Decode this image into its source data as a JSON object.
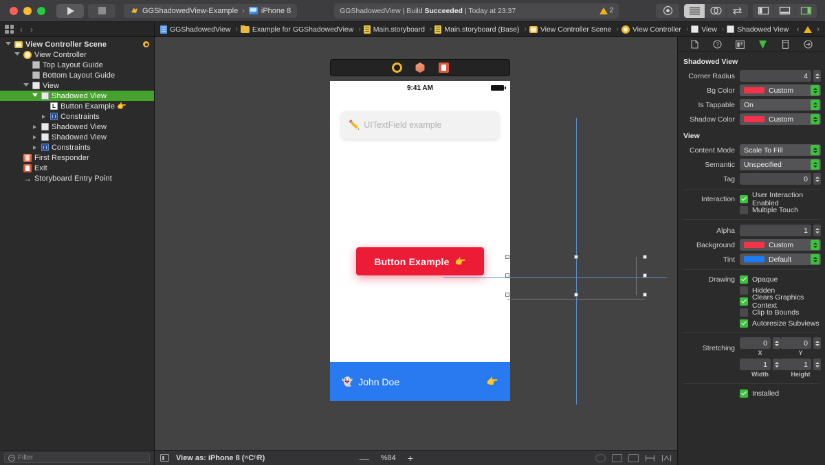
{
  "toolbar": {
    "run_icon": "play-icon",
    "stop_icon": "stop-icon",
    "scheme_name": "GGShadowedView-Example",
    "scheme_separator": "›",
    "destination": "iPhone 8",
    "status_prefix": "GGShadowedView | Build ",
    "status_result": "Succeeded",
    "status_suffix": " | Today at 23:37",
    "warning_count": "2",
    "buttons": {
      "library": "library-button",
      "standard_editor": "standard-editor-button",
      "assistant_editor": "assistant-editor-button",
      "version_editor": "version-editor-button",
      "navigator_toggle": "hide-navigator-button",
      "debug_toggle": "hide-debug-area-button",
      "inspector_toggle": "hide-inspector-button"
    }
  },
  "breadcrumb": {
    "back_label": "‹",
    "forward_label": "›",
    "items": [
      {
        "label": "GGShadowedView",
        "icon": "project-doc-icon"
      },
      {
        "label": "Example for GGShadowedView",
        "icon": "folder-icon"
      },
      {
        "label": "Main.storyboard",
        "icon": "storyboard-icon"
      },
      {
        "label": "Main.storyboard (Base)",
        "icon": "storyboard-icon"
      },
      {
        "label": "View Controller Scene",
        "icon": "scene-icon"
      },
      {
        "label": "View Controller",
        "icon": "view-controller-icon"
      },
      {
        "label": "View",
        "icon": "view-icon"
      },
      {
        "label": "Shadowed View",
        "icon": "view-icon"
      }
    ],
    "issue_prev": "‹",
    "issue_next": "›"
  },
  "navigator": {
    "tree": [
      {
        "label": "View Controller Scene",
        "indent": 0,
        "twisty": "open",
        "icon": "scene-icon",
        "bold": true,
        "selected": false,
        "badge": true
      },
      {
        "label": "View Controller",
        "indent": 1,
        "twisty": "open",
        "icon": "view-controller-icon",
        "bold": false,
        "selected": false
      },
      {
        "label": "Top Layout Guide",
        "indent": 2,
        "twisty": "none",
        "icon": "guide-icon",
        "bold": false,
        "selected": false
      },
      {
        "label": "Bottom Layout Guide",
        "indent": 2,
        "twisty": "none",
        "icon": "guide-icon",
        "bold": false,
        "selected": false
      },
      {
        "label": "View",
        "indent": 2,
        "twisty": "open",
        "icon": "view-icon",
        "bold": false,
        "selected": false
      },
      {
        "label": "Shadowed View",
        "indent": 3,
        "twisty": "open",
        "icon": "view-icon",
        "bold": false,
        "selected": true
      },
      {
        "label": "Button Example 👉",
        "indent": 4,
        "twisty": "none",
        "icon": "label-icon",
        "bold": false,
        "selected": false
      },
      {
        "label": "Constraints",
        "indent": 4,
        "twisty": "closed",
        "icon": "constraints-icon",
        "bold": false,
        "selected": false
      },
      {
        "label": "Shadowed View",
        "indent": 3,
        "twisty": "closed",
        "icon": "view-icon",
        "bold": false,
        "selected": false
      },
      {
        "label": "Shadowed View",
        "indent": 3,
        "twisty": "closed",
        "icon": "view-icon",
        "bold": false,
        "selected": false
      },
      {
        "label": "Constraints",
        "indent": 3,
        "twisty": "closed",
        "icon": "constraints-icon",
        "bold": false,
        "selected": false
      },
      {
        "label": "First Responder",
        "indent": 1,
        "twisty": "none",
        "icon": "first-responder-icon",
        "bold": false,
        "selected": false
      },
      {
        "label": "Exit",
        "indent": 1,
        "twisty": "none",
        "icon": "exit-icon",
        "bold": false,
        "selected": false
      },
      {
        "label": "Storyboard Entry Point",
        "indent": 1,
        "twisty": "none",
        "icon": "entry-point-icon",
        "bold": false,
        "selected": false
      }
    ],
    "filter_placeholder": "Filter",
    "selection_color": "#46a22c"
  },
  "canvas": {
    "dock_icons": [
      "view-controller-icon",
      "first-responder-icon",
      "exit-icon"
    ],
    "status_time": "9:41 AM",
    "textfield_placeholder": "UITextField example",
    "textfield_icon": "✏️",
    "button_label": "Button Example",
    "button_emoji": "👉",
    "button_color": "#ed1c36",
    "footer_name": "John Doe",
    "footer_emoji": "👻",
    "footer_action_emoji": "👉",
    "footer_color": "#2979f0"
  },
  "bottombar": {
    "view_as_prefix": "View as: iPhone 8 (",
    "size_class_w": "w",
    "size_class_wc": "C",
    "size_class_h": "h",
    "size_class_hr": "R",
    "view_as_suffix": ")",
    "zoom_out": "—",
    "zoom_level": "%84",
    "zoom_in": "+",
    "autolayout_icons": [
      "update-frames-icon",
      "embed-in-icon",
      "align-icon",
      "add-constraints-icon",
      "resolve-issues-icon"
    ]
  },
  "inspector": {
    "tabs": [
      {
        "name": "file-inspector-tab",
        "selected": false
      },
      {
        "name": "quick-help-inspector-tab",
        "selected": false
      },
      {
        "name": "identity-inspector-tab",
        "selected": false
      },
      {
        "name": "attributes-inspector-tab",
        "selected": true
      },
      {
        "name": "size-inspector-tab",
        "selected": false
      },
      {
        "name": "connections-inspector-tab",
        "selected": false
      }
    ],
    "sections": [
      {
        "title": "Shadowed View",
        "rows": [
          {
            "type": "stepper",
            "label": "Corner Radius",
            "value": "4"
          },
          {
            "type": "color",
            "label": "Bg Color",
            "value": "Custom",
            "swatch": "#f4334a"
          },
          {
            "type": "popup",
            "label": "Is Tappable",
            "value": "On"
          },
          {
            "type": "color",
            "label": "Shadow Color",
            "value": "Custom",
            "swatch": "#f4334a"
          }
        ]
      },
      {
        "title": "View",
        "rows": [
          {
            "type": "popup",
            "label": "Content Mode",
            "value": "Scale To Fill"
          },
          {
            "type": "popup",
            "label": "Semantic",
            "value": "Unspecified"
          },
          {
            "type": "stepper",
            "label": "Tag",
            "value": "0"
          }
        ]
      }
    ],
    "interaction": {
      "label": "Interaction",
      "items": [
        {
          "label": "User Interaction Enabled",
          "checked": true
        },
        {
          "label": "Multiple Touch",
          "checked": false
        }
      ]
    },
    "alpha": {
      "label": "Alpha",
      "value": "1"
    },
    "background": {
      "label": "Background",
      "value": "Custom",
      "swatch": "#f4334a",
      "plus": "+"
    },
    "tint": {
      "label": "Tint",
      "value": "Default",
      "swatch": "#1d7cf2",
      "plus": "+"
    },
    "drawing": {
      "label": "Drawing",
      "plus": "+",
      "items": [
        {
          "label": "Opaque",
          "checked": true
        },
        {
          "label": "Hidden",
          "checked": false
        },
        {
          "label": "Clears Graphics Context",
          "checked": true
        },
        {
          "label": "Clip to Bounds",
          "checked": false
        },
        {
          "label": "Autoresize Subviews",
          "checked": true
        }
      ]
    },
    "stretching": {
      "label": "Stretching",
      "x": {
        "value": "0",
        "caption": "X"
      },
      "y": {
        "value": "0",
        "caption": "Y"
      },
      "width": {
        "value": "1",
        "caption": "Width"
      },
      "height": {
        "value": "1",
        "caption": "Height"
      }
    },
    "installed": {
      "label": "Installed",
      "checked": true,
      "plus": "+"
    }
  }
}
